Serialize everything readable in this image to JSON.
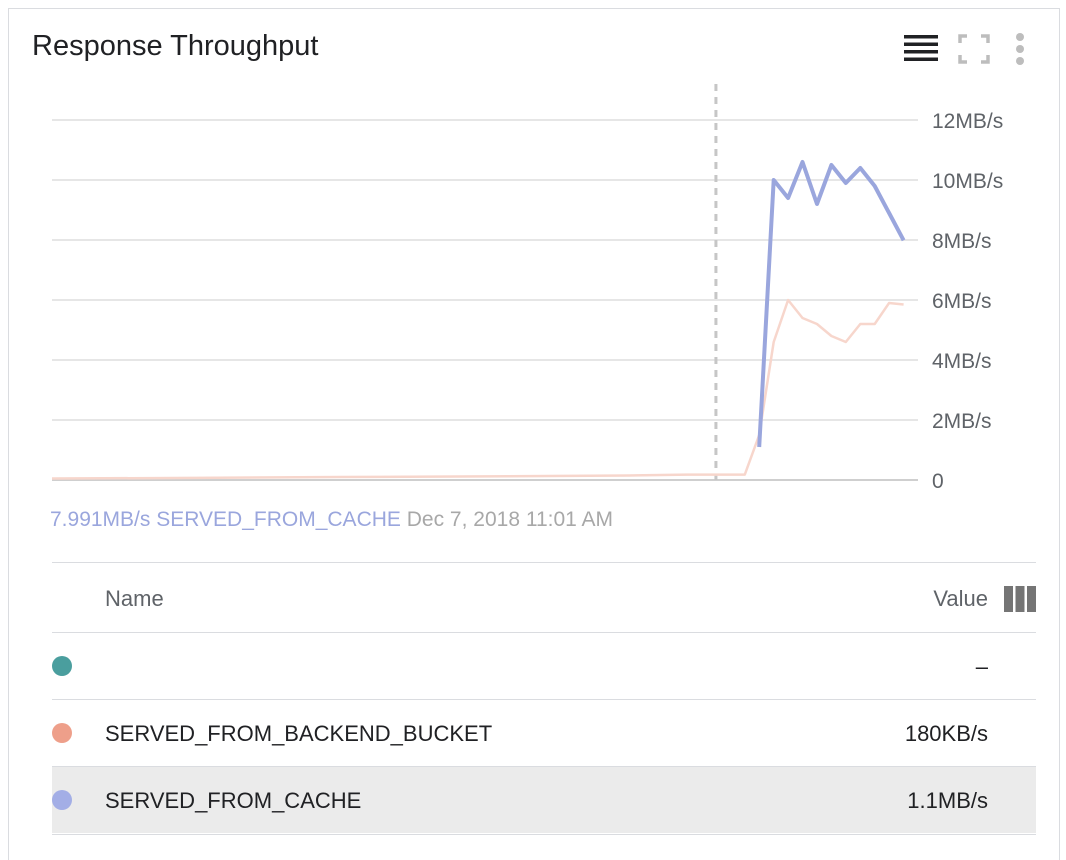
{
  "widget": {
    "title": "Response Throughput",
    "toolbar_icons": [
      "legend-icon",
      "fullscreen-icon",
      "more-vert-icon"
    ]
  },
  "readout": {
    "value": "7.991MB/s",
    "series": "SERVED_FROM_CACHE",
    "timestamp": "Dec 7, 2018 11:01 AM"
  },
  "table": {
    "header_name": "Name",
    "header_value": "Value",
    "column_picker_icon": "view-column-icon",
    "rows": [
      {
        "name": "",
        "value": "–",
        "color": "#4a9e9e",
        "highlighted": false
      },
      {
        "name": "SERVED_FROM_BACKEND_BUCKET",
        "value": "180KB/s",
        "color": "#ee9f8a",
        "highlighted": false
      },
      {
        "name": "SERVED_FROM_CACHE",
        "value": "1.1MB/s",
        "color": "#a3aee6",
        "highlighted": true
      }
    ]
  },
  "chart_data": {
    "type": "line",
    "title": "Response Throughput",
    "xlabel": "",
    "ylabel": "",
    "ylim": [
      0,
      12
    ],
    "y_unit": "MB/s",
    "yticks": [
      {
        "value": 0,
        "label": "0"
      },
      {
        "value": 2,
        "label": "2MB/s"
      },
      {
        "value": 4,
        "label": "4MB/s"
      },
      {
        "value": 6,
        "label": "6MB/s"
      },
      {
        "value": 8,
        "label": "8MB/s"
      },
      {
        "value": 10,
        "label": "10MB/s"
      },
      {
        "value": 12,
        "label": "12MB/s"
      }
    ],
    "grid": true,
    "x_index_range": [
      0,
      60
    ],
    "cursor_x": 46,
    "series": [
      {
        "name": "SERVED_FROM_BACKEND_BUCKET",
        "color": "#f7d6cc",
        "x": [
          0,
          10,
          20,
          30,
          40,
          44,
          48,
          49,
          50,
          51,
          52,
          53,
          54,
          55,
          56,
          57,
          58,
          59
        ],
        "values": [
          0.05,
          0.07,
          0.1,
          0.12,
          0.15,
          0.18,
          0.18,
          1.5,
          4.6,
          6.0,
          5.4,
          5.2,
          4.8,
          4.6,
          5.2,
          5.2,
          5.9,
          5.85
        ]
      },
      {
        "name": "SERVED_FROM_CACHE",
        "color": "#9aa6dd",
        "x": [
          49,
          50,
          51,
          52,
          53,
          54,
          55,
          56,
          57,
          58,
          59
        ],
        "values": [
          1.1,
          10.0,
          9.4,
          10.6,
          9.2,
          10.5,
          9.9,
          10.4,
          9.8,
          8.9,
          7.991
        ]
      }
    ]
  }
}
